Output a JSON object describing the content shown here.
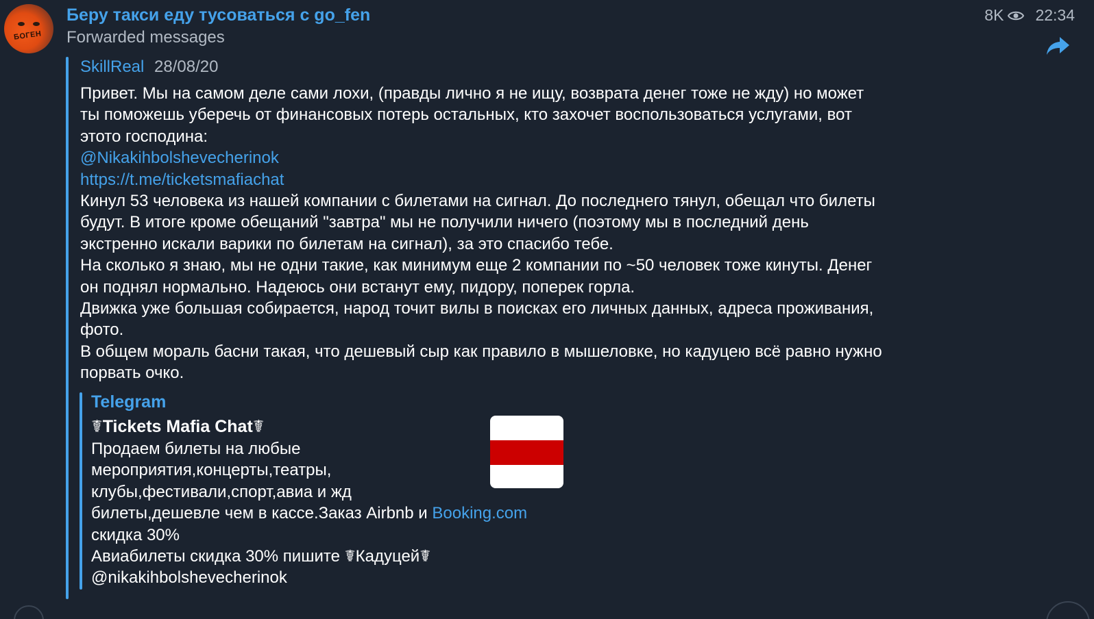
{
  "chat": {
    "title": "Беру такси еду тусоваться с go_fen",
    "subtitle": "Forwarded messages",
    "views": "8K",
    "time": "22:34"
  },
  "icons": {
    "views": "eye-icon",
    "forward": "share-arrow-icon",
    "avatar_text": "БОГЕН"
  },
  "forwarded": {
    "sender": "SkillReal",
    "date": "28/08/20",
    "lines": [
      {
        "text": "Привет. Мы на самом деле сами лохи, (правды лично я не ищу, возврата денег тоже не жду) но может",
        "type": "text"
      },
      {
        "text": "ты поможешь уберечь от финансовых потерь остальных, кто захочет воспользоваться услугами, вот",
        "type": "text"
      },
      {
        "text": "этото господина:",
        "type": "text"
      },
      {
        "text": "@Nikakihbolshevecherinok",
        "type": "link"
      },
      {
        "text": "https://t.me/ticketsmafiachat",
        "type": "link"
      },
      {
        "text": "Кинул 53 человека из нашей компании с билетами на сигнал. До последнего тянул, обещал что билеты",
        "type": "text"
      },
      {
        "text": "будут. В итоге кроме обещаний \"завтра\" мы не получили ничего (поэтому мы в последний день",
        "type": "text"
      },
      {
        "text": "экстренно искали варики по билетам на сигнал), за это спасибо тебе.",
        "type": "text"
      },
      {
        "text": "На сколько я знаю, мы не одни такие, как минимум еще 2 компании по ~50 человек тоже кинуты. Денег",
        "type": "text"
      },
      {
        "text": "он поднял нормально. Надеюсь они встанут ему, пидору, поперек горла.",
        "type": "text"
      },
      {
        "text": "Движка уже большая собирается, народ точит вилы в поисках его личных данных, адреса проживания,",
        "type": "text"
      },
      {
        "text": "фото.",
        "type": "text"
      },
      {
        "text": "В общем мораль басни такая, что дешевый сыр как правило в мышеловке, но кадуцею всё равно нужно",
        "type": "text"
      },
      {
        "text": "порвать очко.",
        "type": "text"
      }
    ]
  },
  "preview": {
    "site": "Telegram",
    "title": "☤Tickets Mafia Chat☤",
    "desc_lines": [
      {
        "text": "Продаем билеты на любые"
      },
      {
        "text": "мероприятия,концерты,театры,"
      },
      {
        "text": "клубы,фестивали,спорт,авиа и жд"
      },
      {
        "text": "билеты,дешевле чем в кассе.Заказ Airbnb и ",
        "link": "Booking.com"
      },
      {
        "text": "скидка 30%"
      },
      {
        "text": "Авиабилеты скидка 30% пишите  ☤Кадуцей☤"
      },
      {
        "text": "@nikakihbolshevecherinok"
      }
    ],
    "image_colors": {
      "top": "#ffffff",
      "middle": "#cc0000",
      "bottom": "#ffffff"
    }
  },
  "colors": {
    "accent": "#45a2ea",
    "background": "#1b232f",
    "muted": "#b2bac4"
  }
}
